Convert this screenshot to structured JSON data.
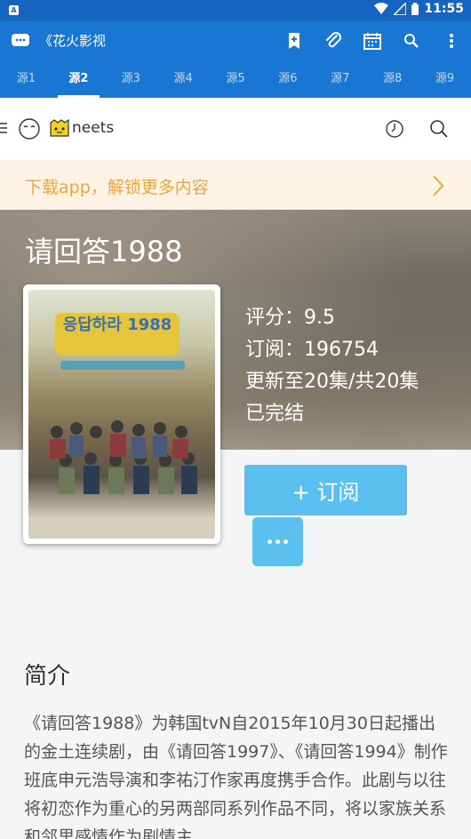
{
  "status_bar": {
    "time": "11:55"
  },
  "app_bar": {
    "title": "《花火影视"
  },
  "tabs": [
    "源1",
    "源2",
    "源3",
    "源4",
    "源5",
    "源6",
    "源7",
    "源8",
    "源9"
  ],
  "active_tab": 1,
  "site": {
    "logo_text": "neets"
  },
  "banner": {
    "text": "下载app，解锁更多内容"
  },
  "show": {
    "title": "请回答1988",
    "rating": "评分：9.5",
    "subscriptions": "订阅：196754",
    "episodes": "更新至20集/共20集",
    "status": "已完结",
    "poster_title": "응답하라 1988"
  },
  "actions": {
    "subscribe_label": "+ 订阅"
  },
  "intro": {
    "heading": "简介",
    "text": "《请回答1988》为韩国tvN自2015年10月30日起播出的金土连续剧，由《请回答1997》、《请回答1994》制作班底申元浩导演和李祐汀作家再度携手合作。此剧与以往将初恋作为重心的另两部同系列作品不同，将以家族关系和邻里感情作为剧情主"
  },
  "colors": {
    "primary": "#1976d2",
    "accent": "#5bc0f0",
    "banner_text": "#f0a43c"
  }
}
